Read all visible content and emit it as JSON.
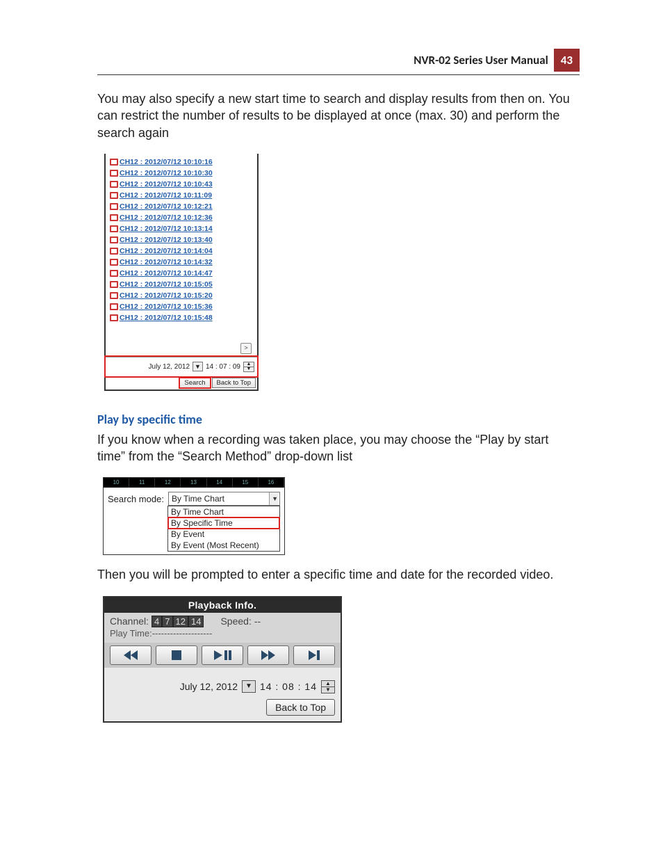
{
  "header": {
    "title": "NVR-02 Series User Manual",
    "page_number": "43"
  },
  "intro_text": "You may also specify a new start time to search and display results from then on. You can restrict the number of results to be displayed at once (max. 30) and perform the search again",
  "fig1": {
    "results": [
      "CH12 : 2012/07/12 10:10:16",
      "CH12 : 2012/07/12 10:10:30",
      "CH12 : 2012/07/12 10:10:43",
      "CH12 : 2012/07/12 10:11:09",
      "CH12 : 2012/07/12 10:12:21",
      "CH12 : 2012/07/12 10:12:36",
      "CH12 : 2012/07/12 10:13:14",
      "CH12 : 2012/07/12 10:13:40",
      "CH12 : 2012/07/12 10:14:04",
      "CH12 : 2012/07/12 10:14:32",
      "CH12 : 2012/07/12 10:14:47",
      "CH12 : 2012/07/12 10:15:05",
      "CH12 : 2012/07/12 10:15:20",
      "CH12 : 2012/07/12 10:15:36",
      "CH12 : 2012/07/12 10:15:48"
    ],
    "next_page_glyph": ">",
    "date_value": "July 12, 2012",
    "time_value": "14 : 07 : 09",
    "search_label": "Search",
    "back_label": "Back to Top"
  },
  "heading_play_specific": "Play by specific time",
  "para_play_specific": "If you know when a recording was taken place, you may choose the “Play by start time” from the “Search Method” drop-down list",
  "fig2": {
    "tabs": [
      "10",
      "11",
      "12",
      "13",
      "14",
      "15",
      "16"
    ],
    "label": "Search mode:",
    "selected": "By Time Chart",
    "options": [
      "By Time Chart",
      "By Specific Time",
      "By Event",
      "By Event (Most Recent)"
    ],
    "highlight_index": 1
  },
  "para_prompt": "Then you will be prompted to enter a specific time and date for the recorded video.",
  "fig3": {
    "title": "Playback Info.",
    "channel_label": "Channel:",
    "channels": [
      "4",
      "7",
      "12",
      "14"
    ],
    "speed_label": "Speed:",
    "speed_value": "--",
    "play_time_label": "Play Time:",
    "play_time_value": "--------------------",
    "date_value": "July 12, 2012",
    "time_value": "14 : 08 : 14",
    "back_label": "Back to Top"
  }
}
